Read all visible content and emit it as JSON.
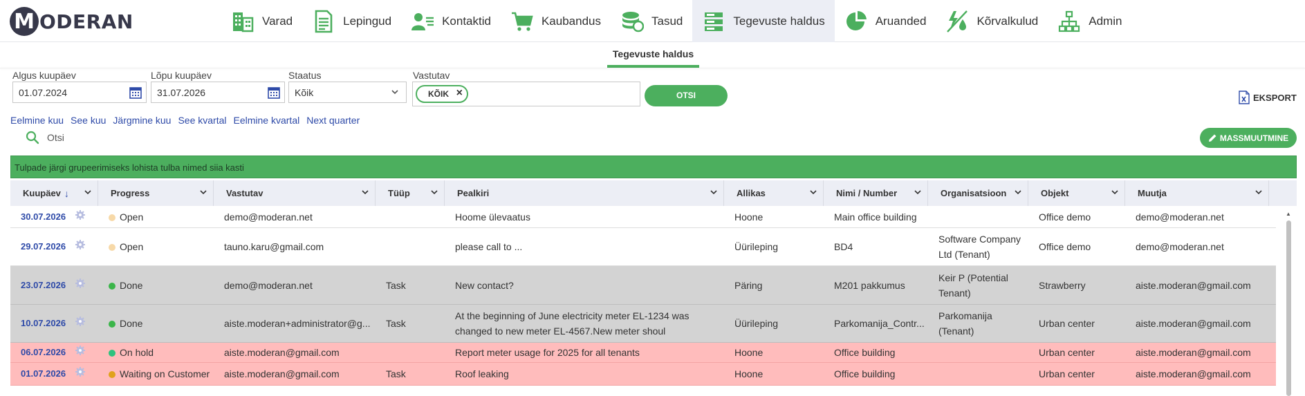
{
  "app": {
    "logo_letter": "M",
    "logo_text": "ODERAN"
  },
  "nav": [
    {
      "label": "Varad",
      "icon": "buildings-icon"
    },
    {
      "label": "Lepingud",
      "icon": "document-icon"
    },
    {
      "label": "Kontaktid",
      "icon": "contacts-icon"
    },
    {
      "label": "Kaubandus",
      "icon": "cart-icon"
    },
    {
      "label": "Tasud",
      "icon": "coins-icon"
    },
    {
      "label": "Tegevuste haldus",
      "icon": "server-list-icon",
      "active": true
    },
    {
      "label": "Aruanded",
      "icon": "pie-chart-icon"
    },
    {
      "label": "Kõrvalkulud",
      "icon": "utilities-icon"
    },
    {
      "label": "Admin",
      "icon": "org-chart-icon"
    }
  ],
  "subtab": {
    "label": "Tegevuste haldus"
  },
  "filters": {
    "start_label": "Algus kuupäev",
    "start_value": "01.07.2024",
    "end_label": "Lõpu kuupäev",
    "end_value": "31.07.2026",
    "status_label": "Staatus",
    "status_value": "Kõik",
    "responsible_label": "Vastutav",
    "responsible_chip": "KÕIK",
    "search_button": "OTSI",
    "export_label": "EKSPORT"
  },
  "quicklinks": [
    "Eelmine kuu",
    "See kuu",
    "Järgmine kuu",
    "See kvartal",
    "Eelmine kvartal",
    "Next quarter"
  ],
  "search": {
    "placeholder": "Otsi"
  },
  "mass_edit_label": "MASSMUUTMINE",
  "group_bar_text": "Tulpade järgi grupeerimiseks lohista tulba nimed siia kasti",
  "columns": [
    "Kuupäev",
    "Progress",
    "Vastutav",
    "Tüüp",
    "Pealkiri",
    "Allikas",
    "Nimi / Number",
    "Organisatsioon",
    "Objekt",
    "Muutja"
  ],
  "colors": {
    "accent": "#4caf5e",
    "link": "#2e4aa8",
    "row_grey": "#d3d3d3",
    "row_red": "#ffbcbc"
  },
  "rows": [
    {
      "date": "30.07.2026",
      "status": "Open",
      "status_color": "#f7d9a8",
      "responsible": "demo@moderan.net",
      "type": "",
      "title": "Hoome ülevaatus",
      "source": "Hoone",
      "name": "Main office building",
      "org": "",
      "object": "Office demo",
      "modifier": "demo@moderan.net",
      "style": "white"
    },
    {
      "date": "29.07.2026",
      "status": "Open",
      "status_color": "#f7d9a8",
      "responsible": "tauno.karu@gmail.com",
      "type": "",
      "title": "please call to ...",
      "source": "Üürileping",
      "name": "BD4",
      "org": "Software Company Ltd (Tenant)",
      "object": "Office demo",
      "modifier": "demo@moderan.net",
      "style": "white"
    },
    {
      "date": "23.07.2026",
      "status": "Done",
      "status_color": "#3bb54a",
      "responsible": "demo@moderan.net",
      "type": "Task",
      "title": "New contact?",
      "source": "Päring",
      "name": "M201 pakkumus",
      "org": "Keir P (Potential Tenant)",
      "object": "Strawberry",
      "modifier": "aiste.moderan@gmail.com",
      "style": "grey"
    },
    {
      "date": "10.07.2026",
      "status": "Done",
      "status_color": "#3bb54a",
      "responsible": "aiste.moderan+administrator@g...",
      "type": "Task",
      "title": "At the beginning of June electricity meter EL-1234 was changed to new meter EL-4567.New meter shoul",
      "source": "Üürileping",
      "name": "Parkomanija_Contr...",
      "org": "Parkomanija (Tenant)",
      "object": "Urban center",
      "modifier": "aiste.moderan@gmail.com",
      "style": "grey"
    },
    {
      "date": "06.07.2026",
      "status": "On hold",
      "status_color": "#2ec27e",
      "responsible": "aiste.moderan@gmail.com",
      "type": "",
      "title": "Report meter usage for 2025 for all tenants",
      "source": "Hoone",
      "name": "Office building",
      "org": "",
      "object": "Urban center",
      "modifier": "aiste.moderan@gmail.com",
      "style": "red"
    },
    {
      "date": "01.07.2026",
      "status": "Waiting on Customer",
      "status_color": "#e0a21b",
      "responsible": "aiste.moderan@gmail.com",
      "type": "Task",
      "title": "Roof leaking",
      "source": "Hoone",
      "name": "Office building",
      "org": "",
      "object": "Urban center",
      "modifier": "aiste.moderan@gmail.com",
      "style": "red"
    }
  ]
}
